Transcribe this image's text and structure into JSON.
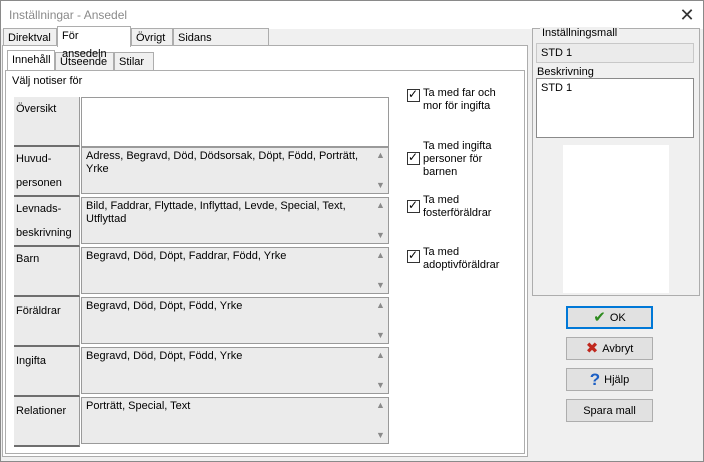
{
  "window": {
    "title": "Inställningar - Ansedel",
    "close_glyph": "✕"
  },
  "tabs_top": [
    {
      "label": "Direktval"
    },
    {
      "label": "För ansedeln"
    },
    {
      "label": "Övrigt"
    },
    {
      "label": "Sidans utformning"
    }
  ],
  "tabs_sub": [
    {
      "label": "Innehåll"
    },
    {
      "label": "Utseende"
    },
    {
      "label": "Stilar"
    }
  ],
  "content": {
    "section_label": "Välj notiser för",
    "overview_label": "Översikt",
    "rows": [
      {
        "label": "Huvud-\npersonen",
        "value": "Adress, Begravd, Död, Dödsorsak, Döpt, Född, Porträtt, Yrke"
      },
      {
        "label": "Levnads-\nbeskrivning",
        "value": "Bild, Faddrar, Flyttade, Inflyttad, Levde, Special, Text, Utflyttad"
      },
      {
        "label": "Barn",
        "value": "Begravd, Död, Döpt, Faddrar, Född, Yrke"
      },
      {
        "label": "Föräldrar",
        "value": "Begravd, Död, Döpt, Född, Yrke"
      },
      {
        "label": "Ingifta",
        "value": "Begravd, Död, Döpt, Född, Yrke"
      },
      {
        "label": "Relationer",
        "value": "Porträtt, Special, Text"
      }
    ],
    "checkboxes": [
      {
        "label": "Ta med far och mor för ingifta",
        "checked": true
      },
      {
        "label": "Ta med ingifta personer för barnen",
        "checked": true
      },
      {
        "label": "Ta med fosterföräldrar",
        "checked": true
      },
      {
        "label": "Ta med adoptivföräldrar",
        "checked": true
      }
    ]
  },
  "settings": {
    "template_label": "Inställningsmall",
    "template_value": "STD 1",
    "description_label": "Beskrivning",
    "description_value": "STD 1"
  },
  "buttons": {
    "ok": "OK",
    "cancel": "Avbryt",
    "help": "Hjälp",
    "save_template": "Spara mall"
  },
  "icons": {
    "ok": "checkmark-icon",
    "cancel": "red-x-icon",
    "help": "question-mark-icon"
  },
  "colors": {
    "ok_icon": "#2e8b1f",
    "cancel_icon": "#c0281e",
    "help_icon": "#1c5fc4",
    "default_button_border": "#0078d7"
  }
}
